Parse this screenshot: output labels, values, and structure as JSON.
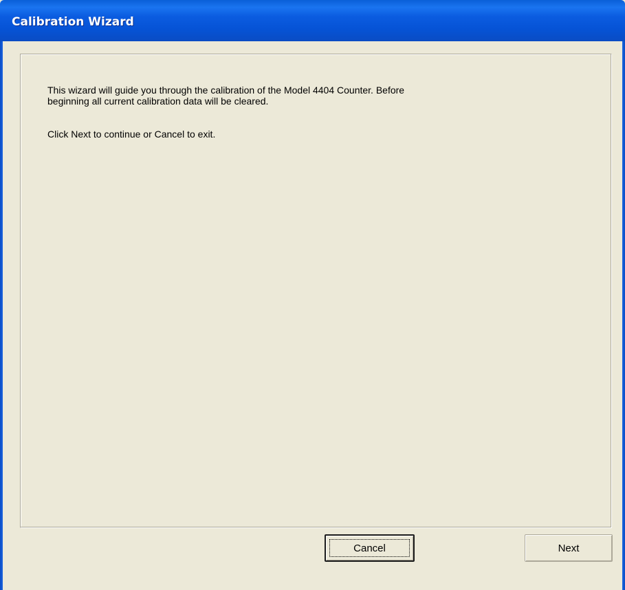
{
  "window": {
    "title": "Calibration Wizard"
  },
  "content": {
    "intro_text": "This wizard will guide you through the calibration of the Model 4404 Counter.  Before\nbeginning all current calibration data will be cleared.",
    "instruction_text": "Click Next to continue or Cancel to exit."
  },
  "buttons": {
    "cancel_label": "Cancel",
    "next_label": "Next"
  },
  "colors": {
    "titlebar_blue": "#0653d6",
    "dialog_background": "#ece9d8",
    "title_text": "#ffffff"
  }
}
